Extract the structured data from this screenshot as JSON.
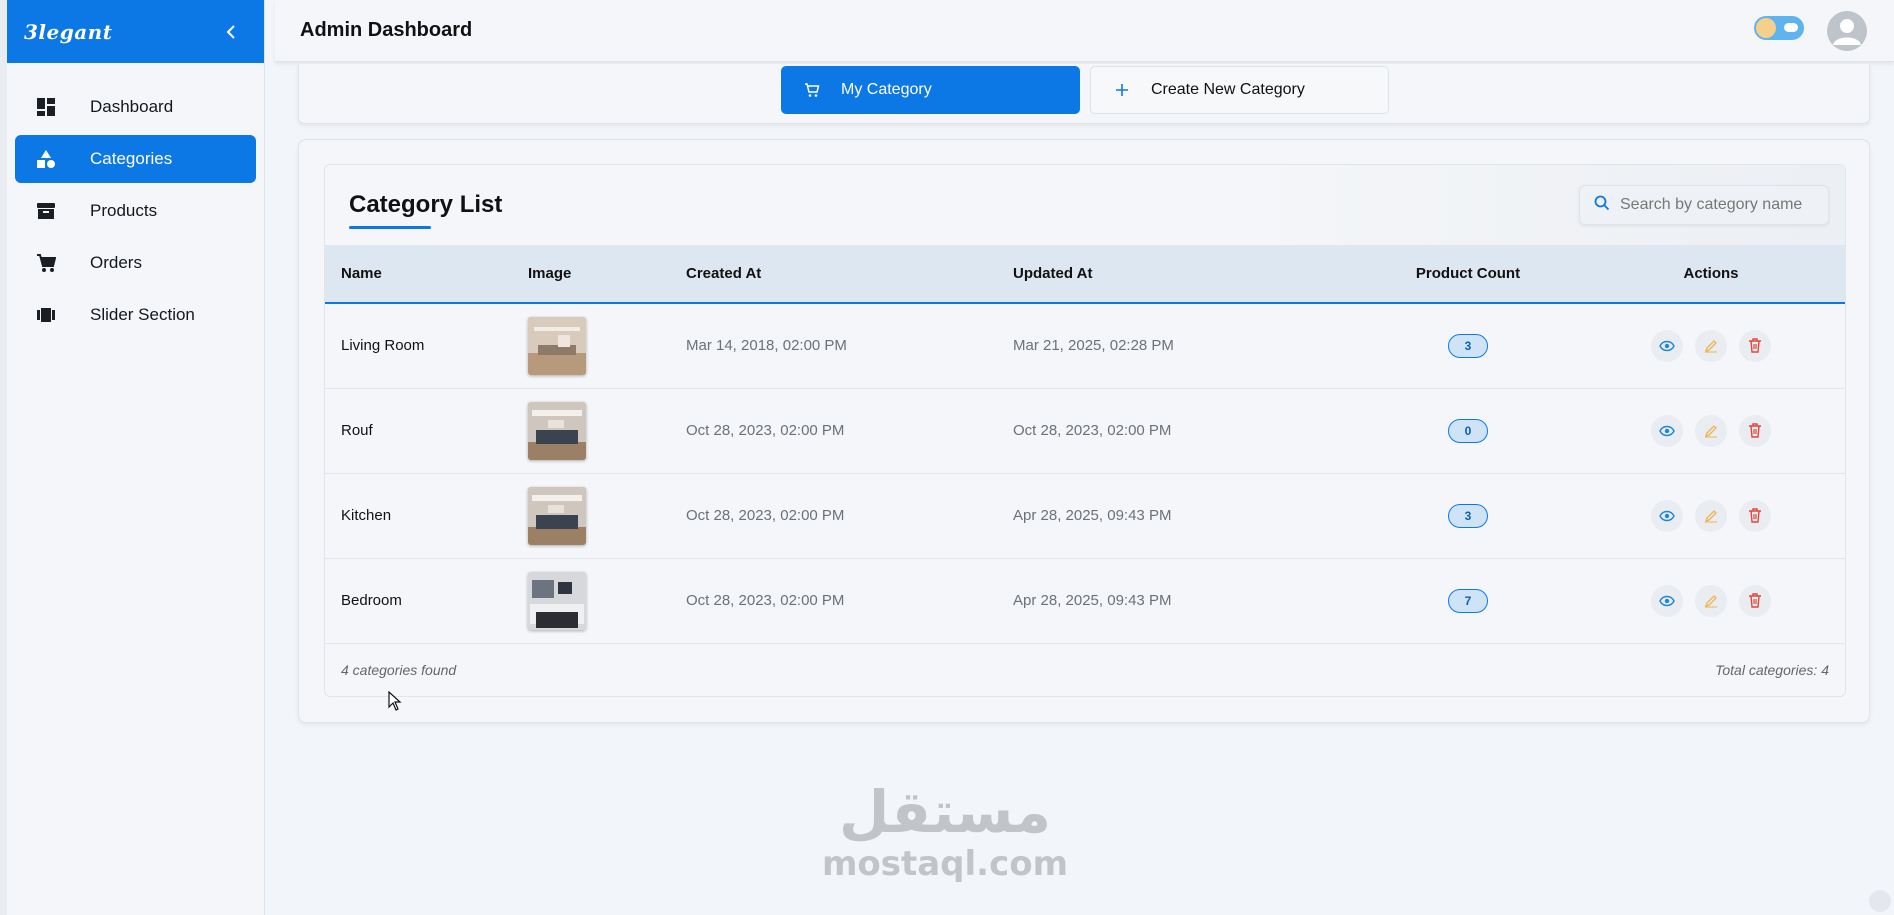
{
  "sidebar": {
    "brand": "3legant",
    "toggle_icon": "chevron-left-icon",
    "items": [
      {
        "label": "Dashboard",
        "icon": "dashboard-icon",
        "active": false
      },
      {
        "label": "Categories",
        "icon": "categories-icon",
        "active": true
      },
      {
        "label": "Products",
        "icon": "archive-box-icon",
        "active": false
      },
      {
        "label": "Orders",
        "icon": "cart-icon",
        "active": false
      },
      {
        "label": "Slider Section",
        "icon": "slider-icon",
        "active": false
      }
    ]
  },
  "header": {
    "title": "Admin Dashboard",
    "theme_toggle_icon": "sun-cloud-toggle-icon",
    "avatar_icon": "user-avatar-icon"
  },
  "tabs": {
    "my_category": "My Category",
    "create_new": "Create New Category"
  },
  "category_list": {
    "title": "Category List",
    "search_placeholder": "Search by category name",
    "columns": [
      "Name",
      "Image",
      "Created At",
      "Updated At",
      "Product Count",
      "Actions"
    ],
    "rows": [
      {
        "name": "Living Room",
        "created": "Mar 14, 2018, 02:00 PM",
        "updated": "Mar 21, 2025, 02:28 PM",
        "count": "3"
      },
      {
        "name": "Rouf",
        "created": "Oct 28, 2023, 02:00 PM",
        "updated": "Oct 28, 2023, 02:00 PM",
        "count": "0"
      },
      {
        "name": "Kitchen",
        "created": "Oct 28, 2023, 02:00 PM",
        "updated": "Apr 28, 2025, 09:43 PM",
        "count": "3"
      },
      {
        "name": "Bedroom",
        "created": "Oct 28, 2023, 02:00 PM",
        "updated": "Apr 28, 2025, 09:43 PM",
        "count": "7"
      }
    ],
    "footer_left": "4 categories found",
    "footer_right": "Total categories: 4"
  },
  "watermark": {
    "arabic": "مستقل",
    "latin": "mostaql.com"
  },
  "colors": {
    "accent": "#0c78e6",
    "view": "#1f86d8",
    "edit": "#f0b34d",
    "delete": "#e0473a"
  }
}
